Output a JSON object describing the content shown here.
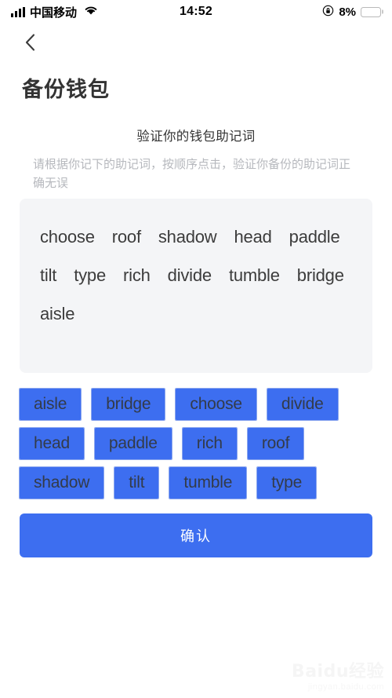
{
  "status_bar": {
    "signal_icon": "signal-bars-icon",
    "carrier": "中国移动",
    "wifi_icon": "wifi-icon",
    "time": "14:52",
    "rotation_lock_icon": "rotation-lock-icon",
    "battery_percent": "8%",
    "battery_level": 8,
    "battery_color": "#f33a2f"
  },
  "nav": {
    "back_icon": "chevron-left-icon"
  },
  "page": {
    "title": "备份钱包",
    "heading": "验证你的钱包助记词",
    "subtitle": "请根据你记下的助记词，按顺序点击，验证你备份的助记词正确无误"
  },
  "selected_panel": {
    "words": [
      "choose",
      "roof",
      "shadow",
      "head",
      "paddle",
      "tilt",
      "type",
      "rich",
      "divide",
      "tumble",
      "bridge",
      "aisle"
    ]
  },
  "word_bank": {
    "chips": [
      "aisle",
      "bridge",
      "choose",
      "divide",
      "head",
      "paddle",
      "rich",
      "roof",
      "shadow",
      "tilt",
      "tumble",
      "type"
    ]
  },
  "confirm": {
    "label": "确认"
  },
  "watermark": {
    "main": "Baidu经验",
    "sub": "jingyan.baidu.com"
  },
  "colors": {
    "accent_blue": "#3d6ef0",
    "panel_gray": "#f4f5f7",
    "text_dark": "#333333",
    "text_muted": "#b6b8bd"
  }
}
